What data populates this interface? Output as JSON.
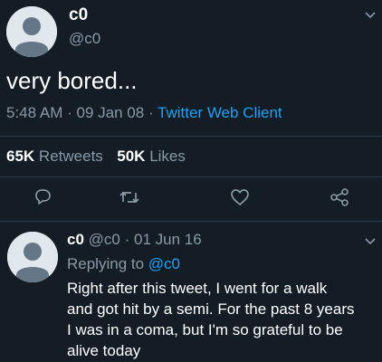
{
  "main_tweet": {
    "display_name": "c0",
    "handle": "@c0",
    "text": "very bored...",
    "time": "5:48 AM",
    "sep1": "·",
    "date": "09 Jan 08",
    "sep2": "·",
    "source": "Twitter Web Client",
    "retweets_count": "65K",
    "retweets_label": "Retweets",
    "likes_count": "50K",
    "likes_label": "Likes",
    "icons": [
      "reply-icon",
      "retweet-icon",
      "like-icon",
      "share-icon"
    ]
  },
  "reply": {
    "display_name": "c0",
    "handle": "@c0",
    "sep": "·",
    "date": "01 Jun 16",
    "replying_to_label": "Replying to",
    "replying_to_handle": "@c0",
    "text_lines": [
      "Right after this tweet, I went for a walk",
      "and got hit by a semi. For the past 8 years",
      "I was in a coma, but I'm so grateful to be",
      "alive today"
    ]
  },
  "colors": {
    "background": "#141d26",
    "text": "#ffffff",
    "secondary": "#8899a6",
    "link": "#1da1f2"
  }
}
